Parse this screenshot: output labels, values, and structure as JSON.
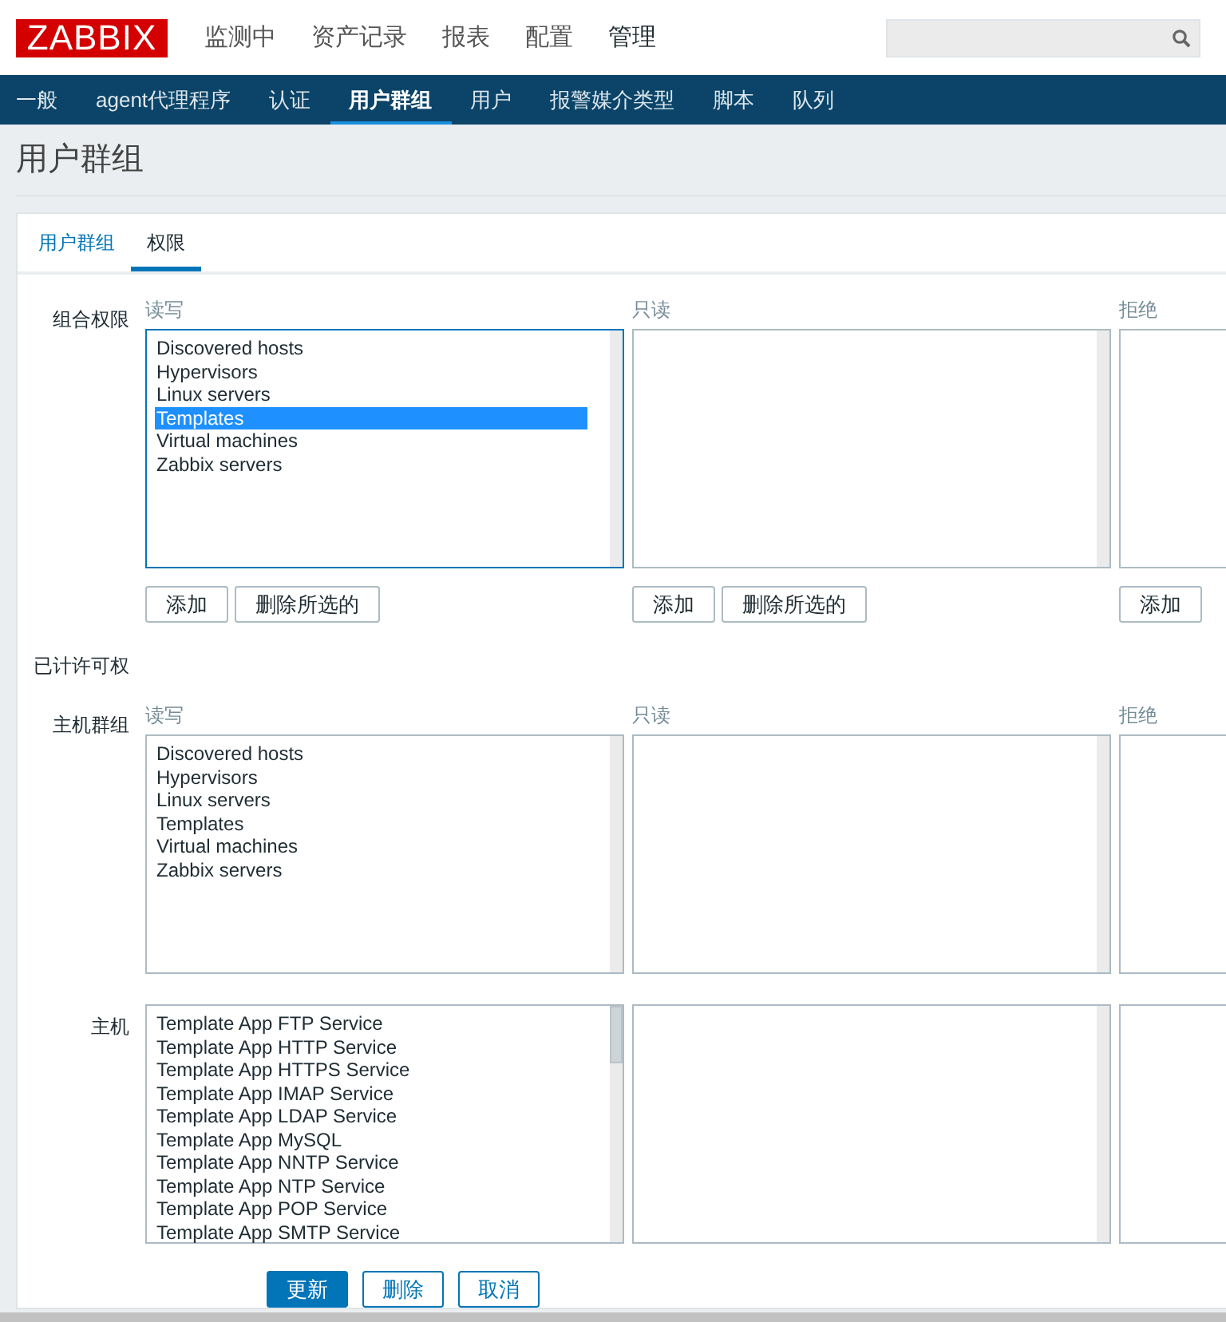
{
  "header": {
    "logo": "ZABBIX",
    "menu": [
      {
        "label": "监测中",
        "selected": false
      },
      {
        "label": "资产记录",
        "selected": false
      },
      {
        "label": "报表",
        "selected": false
      },
      {
        "label": "配置",
        "selected": false
      },
      {
        "label": "管理",
        "selected": true
      }
    ]
  },
  "subnav": [
    {
      "label": "一般",
      "selected": false
    },
    {
      "label": "agent代理程序",
      "selected": false
    },
    {
      "label": "认证",
      "selected": false
    },
    {
      "label": "用户群组",
      "selected": true
    },
    {
      "label": "用户",
      "selected": false
    },
    {
      "label": "报警媒介类型",
      "selected": false
    },
    {
      "label": "脚本",
      "selected": false
    },
    {
      "label": "队列",
      "selected": false
    }
  ],
  "page_title": "用户群组",
  "tabs": [
    {
      "label": "用户群组",
      "selected": false
    },
    {
      "label": "权限",
      "selected": true
    }
  ],
  "sections": [
    {
      "kind": "row",
      "label": "组合权限",
      "columns": [
        {
          "heading": "读写",
          "focused": true,
          "scrollable": false,
          "items": [
            {
              "label": "Discovered hosts",
              "selected": false
            },
            {
              "label": "Hypervisors",
              "selected": false
            },
            {
              "label": "Linux servers",
              "selected": false
            },
            {
              "label": "Templates",
              "selected": true
            },
            {
              "label": "Virtual machines",
              "selected": false
            },
            {
              "label": "Zabbix servers",
              "selected": false
            }
          ],
          "buttons": [
            "添加",
            "删除所选的"
          ]
        },
        {
          "heading": "只读",
          "focused": false,
          "scrollable": false,
          "buttons": [
            "添加",
            "删除所选的"
          ]
        },
        {
          "heading": "拒绝",
          "focused": false,
          "buttons": [
            "添加"
          ]
        }
      ]
    },
    {
      "kind": "heading",
      "label": "已计许可权"
    },
    {
      "kind": "row",
      "label": "主机群组",
      "columns": [
        {
          "heading": "读写",
          "focused": false,
          "scrollable": false,
          "items": [
            {
              "label": "Discovered hosts",
              "selected": false
            },
            {
              "label": "Hypervisors",
              "selected": false
            },
            {
              "label": "Linux servers",
              "selected": false
            },
            {
              "label": "Templates",
              "selected": false
            },
            {
              "label": "Virtual machines",
              "selected": false
            },
            {
              "label": "Zabbix servers",
              "selected": false
            }
          ]
        },
        {
          "heading": "只读",
          "focused": false,
          "scrollable": false
        },
        {
          "heading": "拒绝",
          "focused": false
        }
      ]
    },
    {
      "kind": "row",
      "label": "主机",
      "columns": [
        {
          "focused": false,
          "scrollable": true,
          "items": [
            {
              "label": "Template App FTP Service",
              "selected": false
            },
            {
              "label": "Template App HTTP Service",
              "selected": false
            },
            {
              "label": "Template App HTTPS Service",
              "selected": false
            },
            {
              "label": "Template App IMAP Service",
              "selected": false
            },
            {
              "label": "Template App LDAP Service",
              "selected": false
            },
            {
              "label": "Template App MySQL",
              "selected": false
            },
            {
              "label": "Template App NNTP Service",
              "selected": false
            },
            {
              "label": "Template App NTP Service",
              "selected": false
            },
            {
              "label": "Template App POP Service",
              "selected": false
            },
            {
              "label": "Template App SMTP Service",
              "selected": false
            }
          ]
        },
        {
          "focused": false,
          "scrollable": false
        },
        {
          "focused": false
        }
      ]
    }
  ],
  "actions": [
    {
      "label": "更新",
      "kind": "primary"
    },
    {
      "label": "删除",
      "kind": "secondary"
    },
    {
      "label": "取消",
      "kind": "secondary"
    }
  ]
}
